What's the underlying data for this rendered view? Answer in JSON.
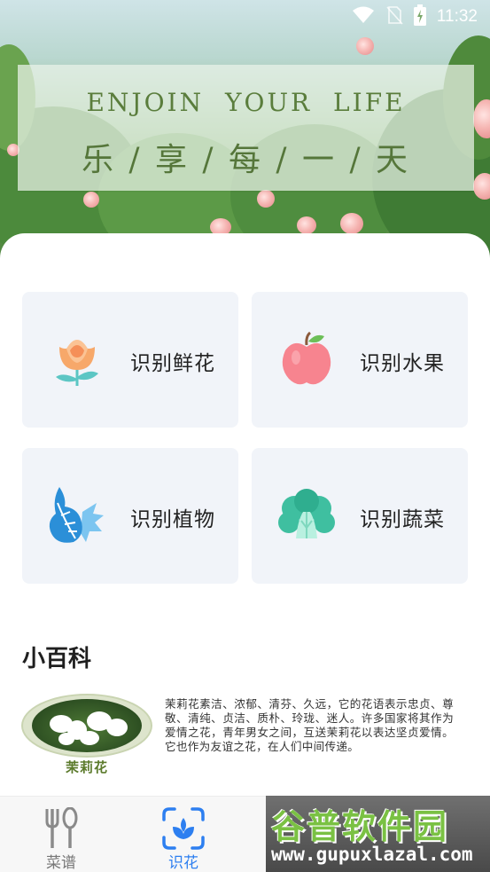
{
  "status_bar": {
    "time": "11:32",
    "icons": [
      "wifi-icon",
      "no-sim-icon",
      "battery-charging-icon"
    ]
  },
  "banner": {
    "title_en": "ENJOIN YOUR LIFE",
    "title_cn": "乐 / 享 / 每 / 一 / 天"
  },
  "cards": [
    {
      "label": "识别鲜花",
      "icon": "flower-icon"
    },
    {
      "label": "识别水果",
      "icon": "apple-icon"
    },
    {
      "label": "识别植物",
      "icon": "leaf-icon"
    },
    {
      "label": "识别蔬菜",
      "icon": "vegetable-icon"
    }
  ],
  "encyclopedia": {
    "title": "小百科",
    "image_caption": "茉莉花",
    "text": "茉莉花素洁、浓郁、清芬、久远，它的花语表示忠贞、尊敬、清纯、贞洁、质朴、玲珑、迷人。许多国家将其作为爱情之花，青年男女之间，互送茉莉花以表达坚贞爱情。它也作为友谊之花，在人们中间传递。"
  },
  "bottom_nav": {
    "items": [
      {
        "label": "菜谱",
        "icon": "fork-spoon-icon",
        "active": false
      },
      {
        "label": "识花",
        "icon": "scan-leaf-icon",
        "active": true
      }
    ]
  },
  "watermark": {
    "big": "谷普软件园",
    "url": "www.gupuxlazal.com"
  },
  "colors": {
    "accent": "#2d7ff0",
    "card_bg": "#f1f4f9",
    "banner_text": "#5a7d3c"
  }
}
